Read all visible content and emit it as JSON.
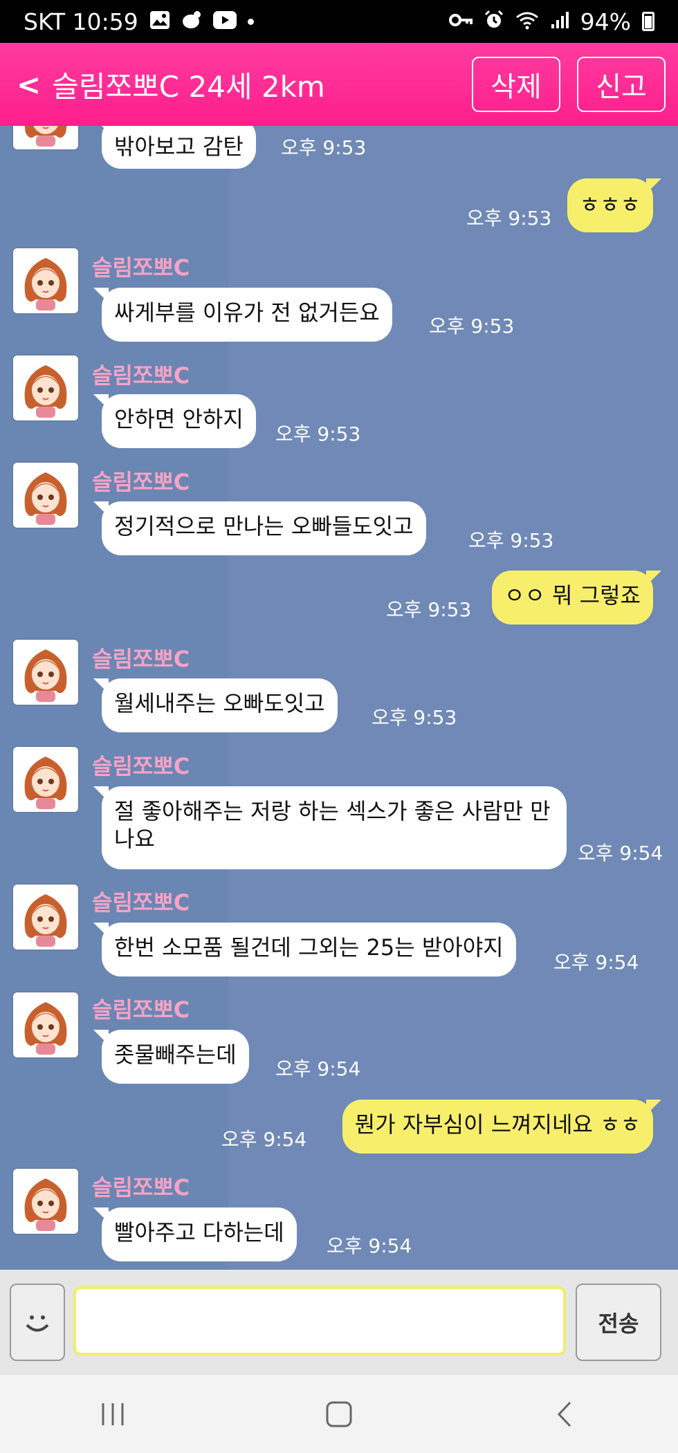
{
  "status_bar": {
    "carrier_time": "SKT 10:59",
    "battery": "94%"
  },
  "header": {
    "title": "슬림쪼뽀C 24세 2km",
    "delete_label": "삭제",
    "report_label": "신고"
  },
  "messages": [
    {
      "dir": "in",
      "text": "밖아보고 감탄",
      "time": "오후 9:53"
    },
    {
      "dir": "out",
      "text": "ㅎㅎㅎ",
      "time": "오후 9:53"
    },
    {
      "dir": "in",
      "name": "슬림쪼뽀C",
      "text": "싸게부를 이유가 전 없거든요",
      "time": "오후 9:53"
    },
    {
      "dir": "in",
      "name": "슬림쪼뽀C",
      "text": "안하면 안하지",
      "time": "오후 9:53"
    },
    {
      "dir": "in",
      "name": "슬림쪼뽀C",
      "text": "정기적으로 만나는 오빠들도잇고",
      "time": "오후 9:53"
    },
    {
      "dir": "out",
      "text": "ㅇㅇ 뭐 그렇죠",
      "time": "오후 9:53"
    },
    {
      "dir": "in",
      "name": "슬림쪼뽀C",
      "text": "월세내주는 오빠도잇고",
      "time": "오후 9:53"
    },
    {
      "dir": "in",
      "name": "슬림쪼뽀C",
      "text": "절 좋아해주는 저랑 하는 섹스가 좋은 사람만 만나요",
      "time": "오후 9:54"
    },
    {
      "dir": "in",
      "name": "슬림쪼뽀C",
      "text": "한번 소모품 될건데 그외는 25는 받아야지",
      "time": "오후 9:54"
    },
    {
      "dir": "in",
      "name": "슬림쪼뽀C",
      "text": "좃물빼주는데",
      "time": "오후 9:54"
    },
    {
      "dir": "out",
      "text": "뭔가 자부심이 느껴지네요 ㅎㅎ",
      "time": "오후 9:54"
    },
    {
      "dir": "in",
      "name": "슬림쪼뽀C",
      "text": "빨아주고 다하는데",
      "time": "오후 9:54"
    }
  ],
  "input": {
    "placeholder": "",
    "send_label": "전송"
  },
  "colors": {
    "header": "#ff2a93",
    "chat_bg": "#6a86b3",
    "out_bubble": "#f7ef6b",
    "name": "#f5a3c6"
  }
}
